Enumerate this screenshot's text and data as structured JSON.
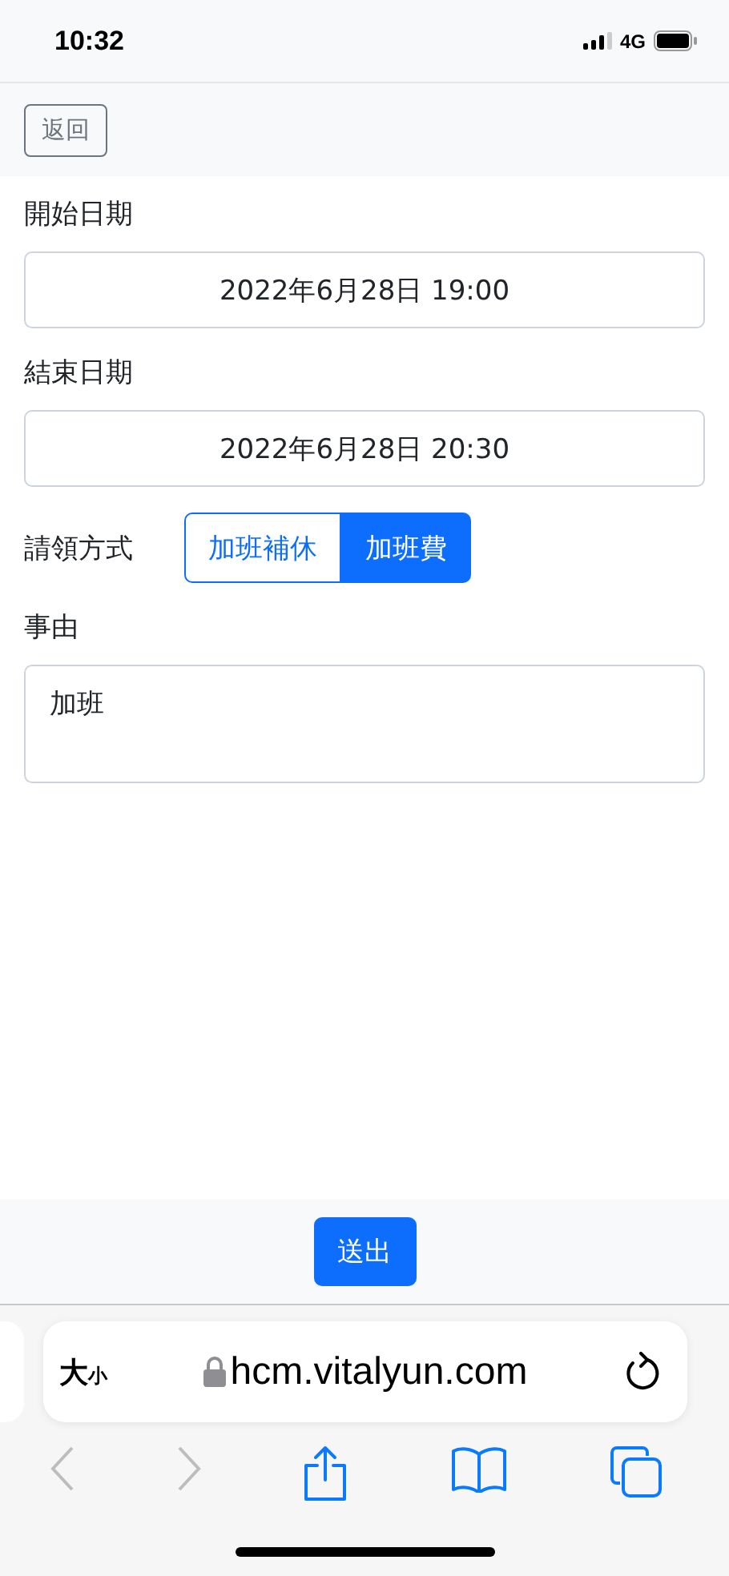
{
  "status_bar": {
    "time": "10:32",
    "network": "4G"
  },
  "back_button": {
    "label": "返回"
  },
  "form": {
    "fields": [
      {
        "kind": "datetime",
        "label": "開始日期",
        "value": "2022年6月28日 19:00"
      },
      {
        "kind": "datetime",
        "label": "結束日期",
        "value": "2022年6月28日 20:30"
      },
      {
        "kind": "choice",
        "label": "請領方式",
        "options": [
          {
            "label": "加班補休",
            "selected": false
          },
          {
            "label": "加班費",
            "selected": true
          }
        ]
      },
      {
        "kind": "textarea",
        "label": "事由",
        "value": "加班"
      }
    ]
  },
  "submit_button": {
    "label": "送出"
  },
  "browser": {
    "text_size_button": {
      "large": "大",
      "small": "小"
    },
    "url": "hcm.vitalyun.com",
    "toolbar": [
      {
        "kind": "back",
        "disabled": true
      },
      {
        "kind": "forward",
        "disabled": true
      },
      {
        "kind": "share",
        "disabled": false
      },
      {
        "kind": "bookmarks",
        "disabled": false
      },
      {
        "kind": "tabs",
        "disabled": false
      }
    ]
  }
}
